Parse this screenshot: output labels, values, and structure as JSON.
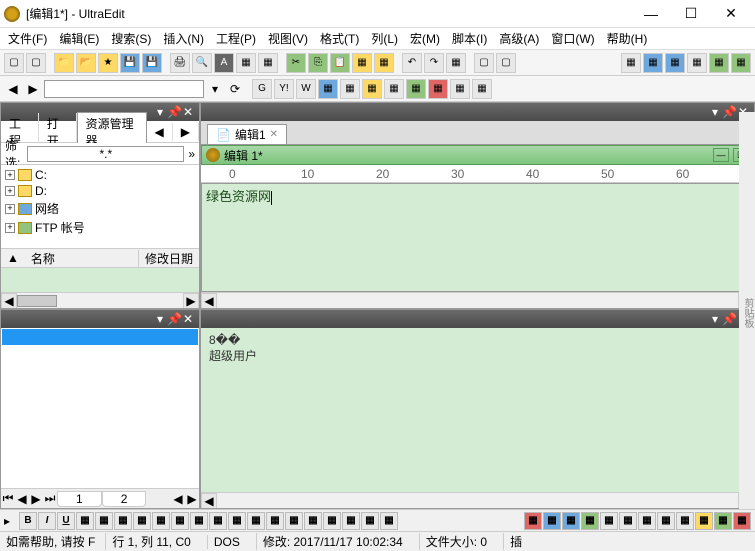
{
  "window": {
    "title": "[编辑1*] - UltraEdit"
  },
  "menu": [
    "文件(F)",
    "编辑(E)",
    "搜索(S)",
    "插入(N)",
    "工程(P)",
    "视图(V)",
    "格式(T)",
    "列(L)",
    "宏(M)",
    "脚本(I)",
    "高级(A)",
    "窗口(W)",
    "帮助(H)"
  ],
  "addressbar": {
    "value": ""
  },
  "explorer": {
    "tabs": {
      "t1": "工程",
      "t2": "打开",
      "t3": "资源管理器"
    },
    "filter_label": "筛选:",
    "filter_value": "*.*",
    "nodes": [
      {
        "label": "C:",
        "icon": "drive"
      },
      {
        "label": "D:",
        "icon": "drive"
      },
      {
        "label": "网络",
        "icon": "net"
      },
      {
        "label": "FTP 帐号",
        "icon": "ftp"
      }
    ],
    "cols": {
      "c1": "名称",
      "c2": "修改日期"
    }
  },
  "editor": {
    "tab_label": "编辑1",
    "child_title": "编辑 1*",
    "ruler": [
      "0",
      "10",
      "20",
      "30",
      "40",
      "50",
      "60"
    ],
    "text": "绿色资源网"
  },
  "output": {
    "tabs": {
      "t1": "1",
      "t2": "2"
    }
  },
  "info_panel": {
    "line1": "8��",
    "line2": "超级用户"
  },
  "bottom_buttons": [
    "B",
    "I",
    "U",
    "",
    "",
    "",
    "",
    "",
    "",
    "",
    "",
    "",
    "",
    "",
    "",
    "",
    "",
    "",
    "",
    "",
    "",
    "",
    "",
    "",
    "",
    "",
    "",
    "",
    "",
    "",
    "",
    "",
    "",
    "",
    "",
    "",
    ""
  ],
  "status": {
    "help": "如需帮助, 请按 F",
    "pos": "行 1, 列 11, C0",
    "enc": "DOS",
    "mod": "修改: 2017/11/17 10:02:34",
    "size": "文件大小: 0",
    "ins": "插"
  },
  "side_label": "剪贴板"
}
